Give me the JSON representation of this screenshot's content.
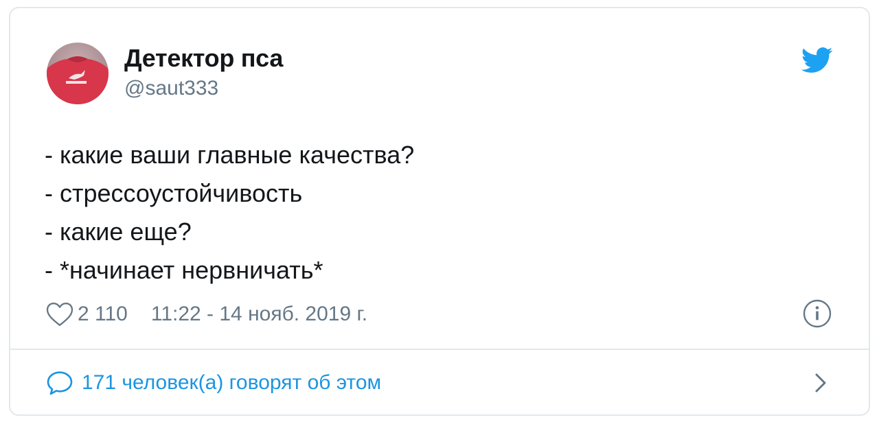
{
  "author": {
    "display_name": "Детектор пса",
    "handle": "@saut333",
    "avatar_icon": "avatar-photo-red-shirt"
  },
  "brand": {
    "icon": "twitter-bird-icon",
    "color": "#1da1f2"
  },
  "tweet": {
    "lines": [
      "- какие ваши главные качества?",
      "- стрессоустойчивость",
      "- какие еще?",
      "- *начинает нервничать*"
    ]
  },
  "meta": {
    "likes": "2 110",
    "timestamp": "11:22 - 14 нояб. 2019 г.",
    "like_icon": "heart-outline-icon",
    "info_icon": "info-icon"
  },
  "footer": {
    "replies_text": "171 человек(а) говорят об этом",
    "reply_icon": "speech-bubble-icon",
    "chevron_icon": "chevron-right-icon"
  },
  "colors": {
    "link": "#1b95e0",
    "muted": "#657786",
    "text": "#14171a",
    "border": "#e1e8ed"
  }
}
